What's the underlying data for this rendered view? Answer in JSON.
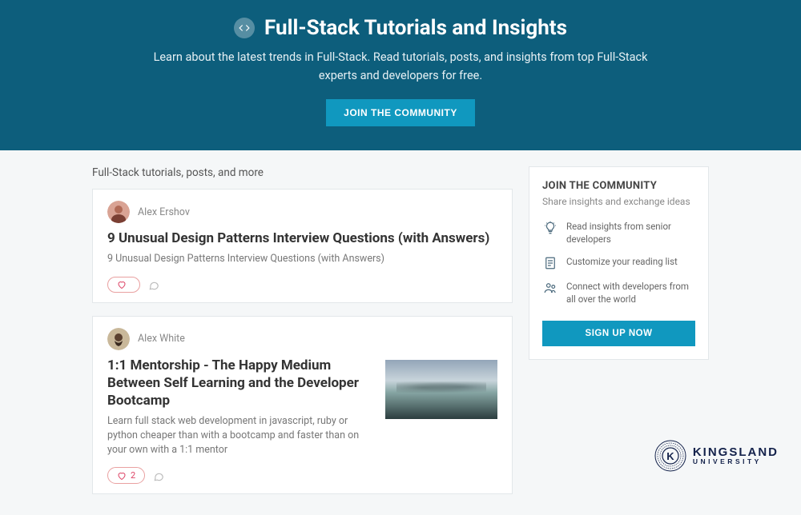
{
  "hero": {
    "title": "Full-Stack Tutorials and Insights",
    "subtitle": "Learn about the latest trends in Full-Stack. Read tutorials, posts, and insights from top Full-Stack experts and developers for free.",
    "cta": "JOIN THE COMMUNITY"
  },
  "section_label": "Full-Stack tutorials, posts, and more",
  "posts": [
    {
      "author": "Alex Ershov",
      "title": "9 Unusual Design Patterns Interview Questions (with Answers)",
      "excerpt": "9 Unusual Design Patterns Interview Questions (with Answers)",
      "likes": "",
      "has_thumb": false
    },
    {
      "author": "Alex White",
      "title": "1:1 Mentorship - The Happy Medium Between Self Learning and the Developer Bootcamp",
      "excerpt": "Learn full stack web development in javascript, ruby or python cheaper than with a bootcamp and faster than on your own with a 1:1 mentor",
      "likes": "2",
      "has_thumb": true
    }
  ],
  "sidebar": {
    "title": "JOIN THE COMMUNITY",
    "subtitle": "Share insights and exchange ideas",
    "benefits": [
      "Read insights from senior developers",
      "Customize your reading list",
      "Connect with developers from all over the world"
    ],
    "cta": "SIGN UP NOW"
  },
  "brand": {
    "line1": "KINGSLAND",
    "line2": "UNIVERSITY"
  }
}
